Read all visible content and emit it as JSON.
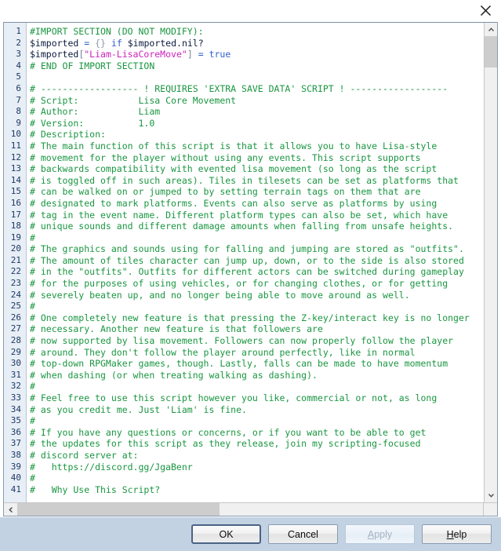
{
  "window": {
    "close_icon": "close-icon"
  },
  "editor": {
    "first_line_number": 1,
    "total_visible_lines": 41,
    "lines": [
      {
        "n": 1,
        "tokens": [
          {
            "t": "#IMPORT SECTION (DO NOT MODIFY):",
            "c": "tok-comment"
          }
        ]
      },
      {
        "n": 2,
        "tokens": [
          {
            "t": "$imported",
            "c": "tok-var"
          },
          {
            "t": " ",
            "c": "tok-plain"
          },
          {
            "t": "=",
            "c": "tok-op"
          },
          {
            "t": " ",
            "c": "tok-plain"
          },
          {
            "t": "{}",
            "c": "tok-brace"
          },
          {
            "t": " ",
            "c": "tok-plain"
          },
          {
            "t": "if",
            "c": "tok-kw"
          },
          {
            "t": " ",
            "c": "tok-plain"
          },
          {
            "t": "$imported.nil?",
            "c": "tok-var"
          }
        ]
      },
      {
        "n": 3,
        "tokens": [
          {
            "t": "$imported",
            "c": "tok-var"
          },
          {
            "t": "[",
            "c": "tok-bracket"
          },
          {
            "t": "\"Liam-LisaCoreMove\"",
            "c": "tok-str"
          },
          {
            "t": "]",
            "c": "tok-bracket"
          },
          {
            "t": " ",
            "c": "tok-plain"
          },
          {
            "t": "=",
            "c": "tok-op"
          },
          {
            "t": " ",
            "c": "tok-plain"
          },
          {
            "t": "true",
            "c": "tok-kw"
          }
        ]
      },
      {
        "n": 4,
        "tokens": [
          {
            "t": "# END OF IMPORT SECTION",
            "c": "tok-comment"
          }
        ]
      },
      {
        "n": 5,
        "tokens": [
          {
            "t": "",
            "c": "tok-plain"
          }
        ]
      },
      {
        "n": 6,
        "tokens": [
          {
            "t": "# ------------------ ! REQUIRES 'EXTRA SAVE DATA' SCRIPT ! ------------------",
            "c": "tok-comment"
          }
        ]
      },
      {
        "n": 7,
        "tokens": [
          {
            "t": "# Script:           Lisa Core Movement",
            "c": "tok-comment"
          }
        ]
      },
      {
        "n": 8,
        "tokens": [
          {
            "t": "# Author:           Liam",
            "c": "tok-comment"
          }
        ]
      },
      {
        "n": 9,
        "tokens": [
          {
            "t": "# Version:          1.0",
            "c": "tok-comment"
          }
        ]
      },
      {
        "n": 10,
        "tokens": [
          {
            "t": "# Description:",
            "c": "tok-comment"
          }
        ]
      },
      {
        "n": 11,
        "tokens": [
          {
            "t": "# The main function of this script is that it allows you to have Lisa-style",
            "c": "tok-comment"
          }
        ]
      },
      {
        "n": 12,
        "tokens": [
          {
            "t": "# movement for the player without using any events. This script supports",
            "c": "tok-comment"
          }
        ]
      },
      {
        "n": 13,
        "tokens": [
          {
            "t": "# backwards compatibility with evented lisa movement (so long as the script",
            "c": "tok-comment"
          }
        ]
      },
      {
        "n": 14,
        "tokens": [
          {
            "t": "# is toggled off in such areas). Tiles in tilesets can be set as platforms that",
            "c": "tok-comment"
          }
        ]
      },
      {
        "n": 15,
        "tokens": [
          {
            "t": "# can be walked on or jumped to by setting terrain tags on them that are",
            "c": "tok-comment"
          }
        ]
      },
      {
        "n": 16,
        "tokens": [
          {
            "t": "# designated to mark platforms. Events can also serve as platforms by using",
            "c": "tok-comment"
          }
        ]
      },
      {
        "n": 17,
        "tokens": [
          {
            "t": "# tag in the event name. Different platform types can also be set, which have",
            "c": "tok-comment"
          }
        ]
      },
      {
        "n": 18,
        "tokens": [
          {
            "t": "# unique sounds and different damage amounts when falling from unsafe heights.",
            "c": "tok-comment"
          }
        ]
      },
      {
        "n": 19,
        "tokens": [
          {
            "t": "#",
            "c": "tok-comment"
          }
        ]
      },
      {
        "n": 20,
        "tokens": [
          {
            "t": "# The graphics and sounds using for falling and jumping are stored as \"outfits\".",
            "c": "tok-comment"
          }
        ]
      },
      {
        "n": 21,
        "tokens": [
          {
            "t": "# The amount of tiles character can jump up, down, or to the side is also stored",
            "c": "tok-comment"
          }
        ]
      },
      {
        "n": 22,
        "tokens": [
          {
            "t": "# in the \"outfits\". Outfits for different actors can be switched during gameplay",
            "c": "tok-comment"
          }
        ]
      },
      {
        "n": 23,
        "tokens": [
          {
            "t": "# for the purposes of using vehicles, or for changing clothes, or for getting",
            "c": "tok-comment"
          }
        ]
      },
      {
        "n": 24,
        "tokens": [
          {
            "t": "# severely beaten up, and no longer being able to move around as well.",
            "c": "tok-comment"
          }
        ]
      },
      {
        "n": 25,
        "tokens": [
          {
            "t": "#",
            "c": "tok-comment"
          }
        ]
      },
      {
        "n": 26,
        "tokens": [
          {
            "t": "# One completely new feature is that pressing the Z-key/interact key is no longer",
            "c": "tok-comment"
          }
        ]
      },
      {
        "n": 27,
        "tokens": [
          {
            "t": "# necessary. Another new feature is that followers are",
            "c": "tok-comment"
          }
        ]
      },
      {
        "n": 28,
        "tokens": [
          {
            "t": "# now supported by lisa movement. Followers can now properly follow the player",
            "c": "tok-comment"
          }
        ]
      },
      {
        "n": 29,
        "tokens": [
          {
            "t": "# around. They don't follow the player around perfectly, like in normal",
            "c": "tok-comment"
          }
        ]
      },
      {
        "n": 30,
        "tokens": [
          {
            "t": "# top-down RPGMaker games, though. Lastly, falls can be made to have momentum",
            "c": "tok-comment"
          }
        ]
      },
      {
        "n": 31,
        "tokens": [
          {
            "t": "# when dashing (or when treating walking as dashing).",
            "c": "tok-comment"
          }
        ]
      },
      {
        "n": 32,
        "tokens": [
          {
            "t": "#",
            "c": "tok-comment"
          }
        ]
      },
      {
        "n": 33,
        "tokens": [
          {
            "t": "# Feel free to use this script however you like, commercial or not, as long",
            "c": "tok-comment"
          }
        ]
      },
      {
        "n": 34,
        "tokens": [
          {
            "t": "# as you credit me. Just 'Liam' is fine.",
            "c": "tok-comment"
          }
        ]
      },
      {
        "n": 35,
        "tokens": [
          {
            "t": "#",
            "c": "tok-comment"
          }
        ]
      },
      {
        "n": 36,
        "tokens": [
          {
            "t": "# If you have any questions or concerns, or if you want to be able to get",
            "c": "tok-comment"
          }
        ]
      },
      {
        "n": 37,
        "tokens": [
          {
            "t": "# the updates for this script as they release, join my scripting-focused",
            "c": "tok-comment"
          }
        ]
      },
      {
        "n": 38,
        "tokens": [
          {
            "t": "# discord server at:",
            "c": "tok-comment"
          }
        ]
      },
      {
        "n": 39,
        "tokens": [
          {
            "t": "#   https://discord.gg/JgaBenr",
            "c": "tok-comment"
          }
        ]
      },
      {
        "n": 40,
        "tokens": [
          {
            "t": "#",
            "c": "tok-comment"
          }
        ]
      },
      {
        "n": 41,
        "tokens": [
          {
            "t": "#   Why Use This Script?",
            "c": "tok-comment"
          }
        ]
      }
    ]
  },
  "scrollbars": {
    "vertical": {
      "up_arrow": "▲",
      "down_arrow": "▼"
    },
    "horizontal": {
      "left_arrow": "◀",
      "right_arrow": "▶"
    }
  },
  "buttons": {
    "ok": {
      "label": "OK",
      "state": "default"
    },
    "cancel": {
      "label": "Cancel",
      "state": "enabled"
    },
    "apply": {
      "label_prefix": "A",
      "label_rest": "pply",
      "state": "disabled"
    },
    "help": {
      "label_prefix": "H",
      "label_rest": "elp",
      "state": "enabled"
    }
  },
  "colors": {
    "comment_green": "#1a9641",
    "string_magenta": "#cc22bb",
    "keyword_blue": "#2f5fd0",
    "gutter_bg": "#e7eef6",
    "gutter_text": "#1f3864",
    "button_bar_bg": "#c3d2e2"
  }
}
